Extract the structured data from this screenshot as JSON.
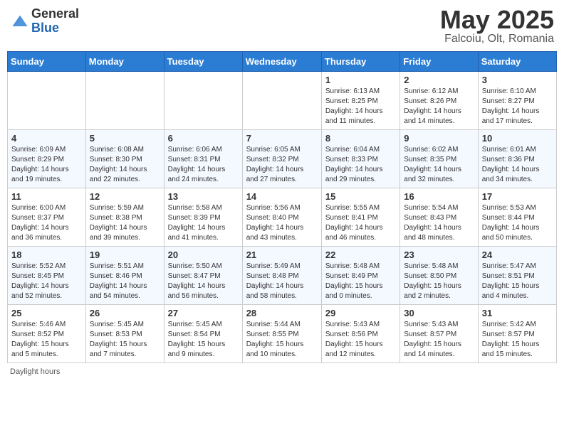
{
  "header": {
    "logo_general": "General",
    "logo_blue": "Blue",
    "month_title": "May 2025",
    "subtitle": "Falcoiu, Olt, Romania"
  },
  "days_of_week": [
    "Sunday",
    "Monday",
    "Tuesday",
    "Wednesday",
    "Thursday",
    "Friday",
    "Saturday"
  ],
  "footer": "Daylight hours",
  "weeks": [
    [
      {
        "day": "",
        "info": ""
      },
      {
        "day": "",
        "info": ""
      },
      {
        "day": "",
        "info": ""
      },
      {
        "day": "",
        "info": ""
      },
      {
        "day": "1",
        "info": "Sunrise: 6:13 AM\nSunset: 8:25 PM\nDaylight: 14 hours\nand 11 minutes."
      },
      {
        "day": "2",
        "info": "Sunrise: 6:12 AM\nSunset: 8:26 PM\nDaylight: 14 hours\nand 14 minutes."
      },
      {
        "day": "3",
        "info": "Sunrise: 6:10 AM\nSunset: 8:27 PM\nDaylight: 14 hours\nand 17 minutes."
      }
    ],
    [
      {
        "day": "4",
        "info": "Sunrise: 6:09 AM\nSunset: 8:29 PM\nDaylight: 14 hours\nand 19 minutes."
      },
      {
        "day": "5",
        "info": "Sunrise: 6:08 AM\nSunset: 8:30 PM\nDaylight: 14 hours\nand 22 minutes."
      },
      {
        "day": "6",
        "info": "Sunrise: 6:06 AM\nSunset: 8:31 PM\nDaylight: 14 hours\nand 24 minutes."
      },
      {
        "day": "7",
        "info": "Sunrise: 6:05 AM\nSunset: 8:32 PM\nDaylight: 14 hours\nand 27 minutes."
      },
      {
        "day": "8",
        "info": "Sunrise: 6:04 AM\nSunset: 8:33 PM\nDaylight: 14 hours\nand 29 minutes."
      },
      {
        "day": "9",
        "info": "Sunrise: 6:02 AM\nSunset: 8:35 PM\nDaylight: 14 hours\nand 32 minutes."
      },
      {
        "day": "10",
        "info": "Sunrise: 6:01 AM\nSunset: 8:36 PM\nDaylight: 14 hours\nand 34 minutes."
      }
    ],
    [
      {
        "day": "11",
        "info": "Sunrise: 6:00 AM\nSunset: 8:37 PM\nDaylight: 14 hours\nand 36 minutes."
      },
      {
        "day": "12",
        "info": "Sunrise: 5:59 AM\nSunset: 8:38 PM\nDaylight: 14 hours\nand 39 minutes."
      },
      {
        "day": "13",
        "info": "Sunrise: 5:58 AM\nSunset: 8:39 PM\nDaylight: 14 hours\nand 41 minutes."
      },
      {
        "day": "14",
        "info": "Sunrise: 5:56 AM\nSunset: 8:40 PM\nDaylight: 14 hours\nand 43 minutes."
      },
      {
        "day": "15",
        "info": "Sunrise: 5:55 AM\nSunset: 8:41 PM\nDaylight: 14 hours\nand 46 minutes."
      },
      {
        "day": "16",
        "info": "Sunrise: 5:54 AM\nSunset: 8:43 PM\nDaylight: 14 hours\nand 48 minutes."
      },
      {
        "day": "17",
        "info": "Sunrise: 5:53 AM\nSunset: 8:44 PM\nDaylight: 14 hours\nand 50 minutes."
      }
    ],
    [
      {
        "day": "18",
        "info": "Sunrise: 5:52 AM\nSunset: 8:45 PM\nDaylight: 14 hours\nand 52 minutes."
      },
      {
        "day": "19",
        "info": "Sunrise: 5:51 AM\nSunset: 8:46 PM\nDaylight: 14 hours\nand 54 minutes."
      },
      {
        "day": "20",
        "info": "Sunrise: 5:50 AM\nSunset: 8:47 PM\nDaylight: 14 hours\nand 56 minutes."
      },
      {
        "day": "21",
        "info": "Sunrise: 5:49 AM\nSunset: 8:48 PM\nDaylight: 14 hours\nand 58 minutes."
      },
      {
        "day": "22",
        "info": "Sunrise: 5:48 AM\nSunset: 8:49 PM\nDaylight: 15 hours\nand 0 minutes."
      },
      {
        "day": "23",
        "info": "Sunrise: 5:48 AM\nSunset: 8:50 PM\nDaylight: 15 hours\nand 2 minutes."
      },
      {
        "day": "24",
        "info": "Sunrise: 5:47 AM\nSunset: 8:51 PM\nDaylight: 15 hours\nand 4 minutes."
      }
    ],
    [
      {
        "day": "25",
        "info": "Sunrise: 5:46 AM\nSunset: 8:52 PM\nDaylight: 15 hours\nand 5 minutes."
      },
      {
        "day": "26",
        "info": "Sunrise: 5:45 AM\nSunset: 8:53 PM\nDaylight: 15 hours\nand 7 minutes."
      },
      {
        "day": "27",
        "info": "Sunrise: 5:45 AM\nSunset: 8:54 PM\nDaylight: 15 hours\nand 9 minutes."
      },
      {
        "day": "28",
        "info": "Sunrise: 5:44 AM\nSunset: 8:55 PM\nDaylight: 15 hours\nand 10 minutes."
      },
      {
        "day": "29",
        "info": "Sunrise: 5:43 AM\nSunset: 8:56 PM\nDaylight: 15 hours\nand 12 minutes."
      },
      {
        "day": "30",
        "info": "Sunrise: 5:43 AM\nSunset: 8:57 PM\nDaylight: 15 hours\nand 14 minutes."
      },
      {
        "day": "31",
        "info": "Sunrise: 5:42 AM\nSunset: 8:57 PM\nDaylight: 15 hours\nand 15 minutes."
      }
    ]
  ]
}
